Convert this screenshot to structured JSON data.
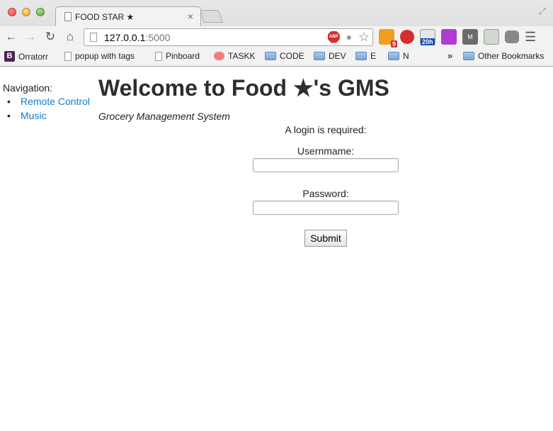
{
  "browser": {
    "tab_title": "FOOD STAR ★",
    "url_host": "127.0.0.1",
    "url_port": ":5000",
    "abp_label": "ABP",
    "rss_badge": "9",
    "calendar_badge": "20h",
    "m_ext_label": "M"
  },
  "bookmarks": [
    {
      "label": "Orratorr",
      "icon": "b-icon"
    },
    {
      "label": "popup with tags",
      "icon": "page-icon"
    },
    {
      "label": "Pinboard",
      "icon": "page-icon"
    },
    {
      "label": "TASKK",
      "icon": "sushi-icon"
    },
    {
      "label": "CODE",
      "icon": "folder-icon"
    },
    {
      "label": "DEV",
      "icon": "folder-icon"
    },
    {
      "label": "E",
      "icon": "folder-icon"
    },
    {
      "label": "N",
      "icon": "folder-icon"
    },
    {
      "label": "Other Bookmarks",
      "icon": "folder-icon"
    }
  ],
  "bookmarks_more": "»",
  "nav": {
    "label": "Navigation:",
    "items": [
      {
        "label": "Remote Control"
      },
      {
        "label": "Music"
      }
    ]
  },
  "main": {
    "title": "Welcome to Food ★'s GMS",
    "subtitle": "Grocery Management System",
    "login_prompt": "A login is required:",
    "username_label": "Usernmame:",
    "password_label": "Password:",
    "submit_label": "Submit"
  },
  "colors": {
    "link": "#1a7ac7",
    "heading": "#2e2e2e"
  }
}
